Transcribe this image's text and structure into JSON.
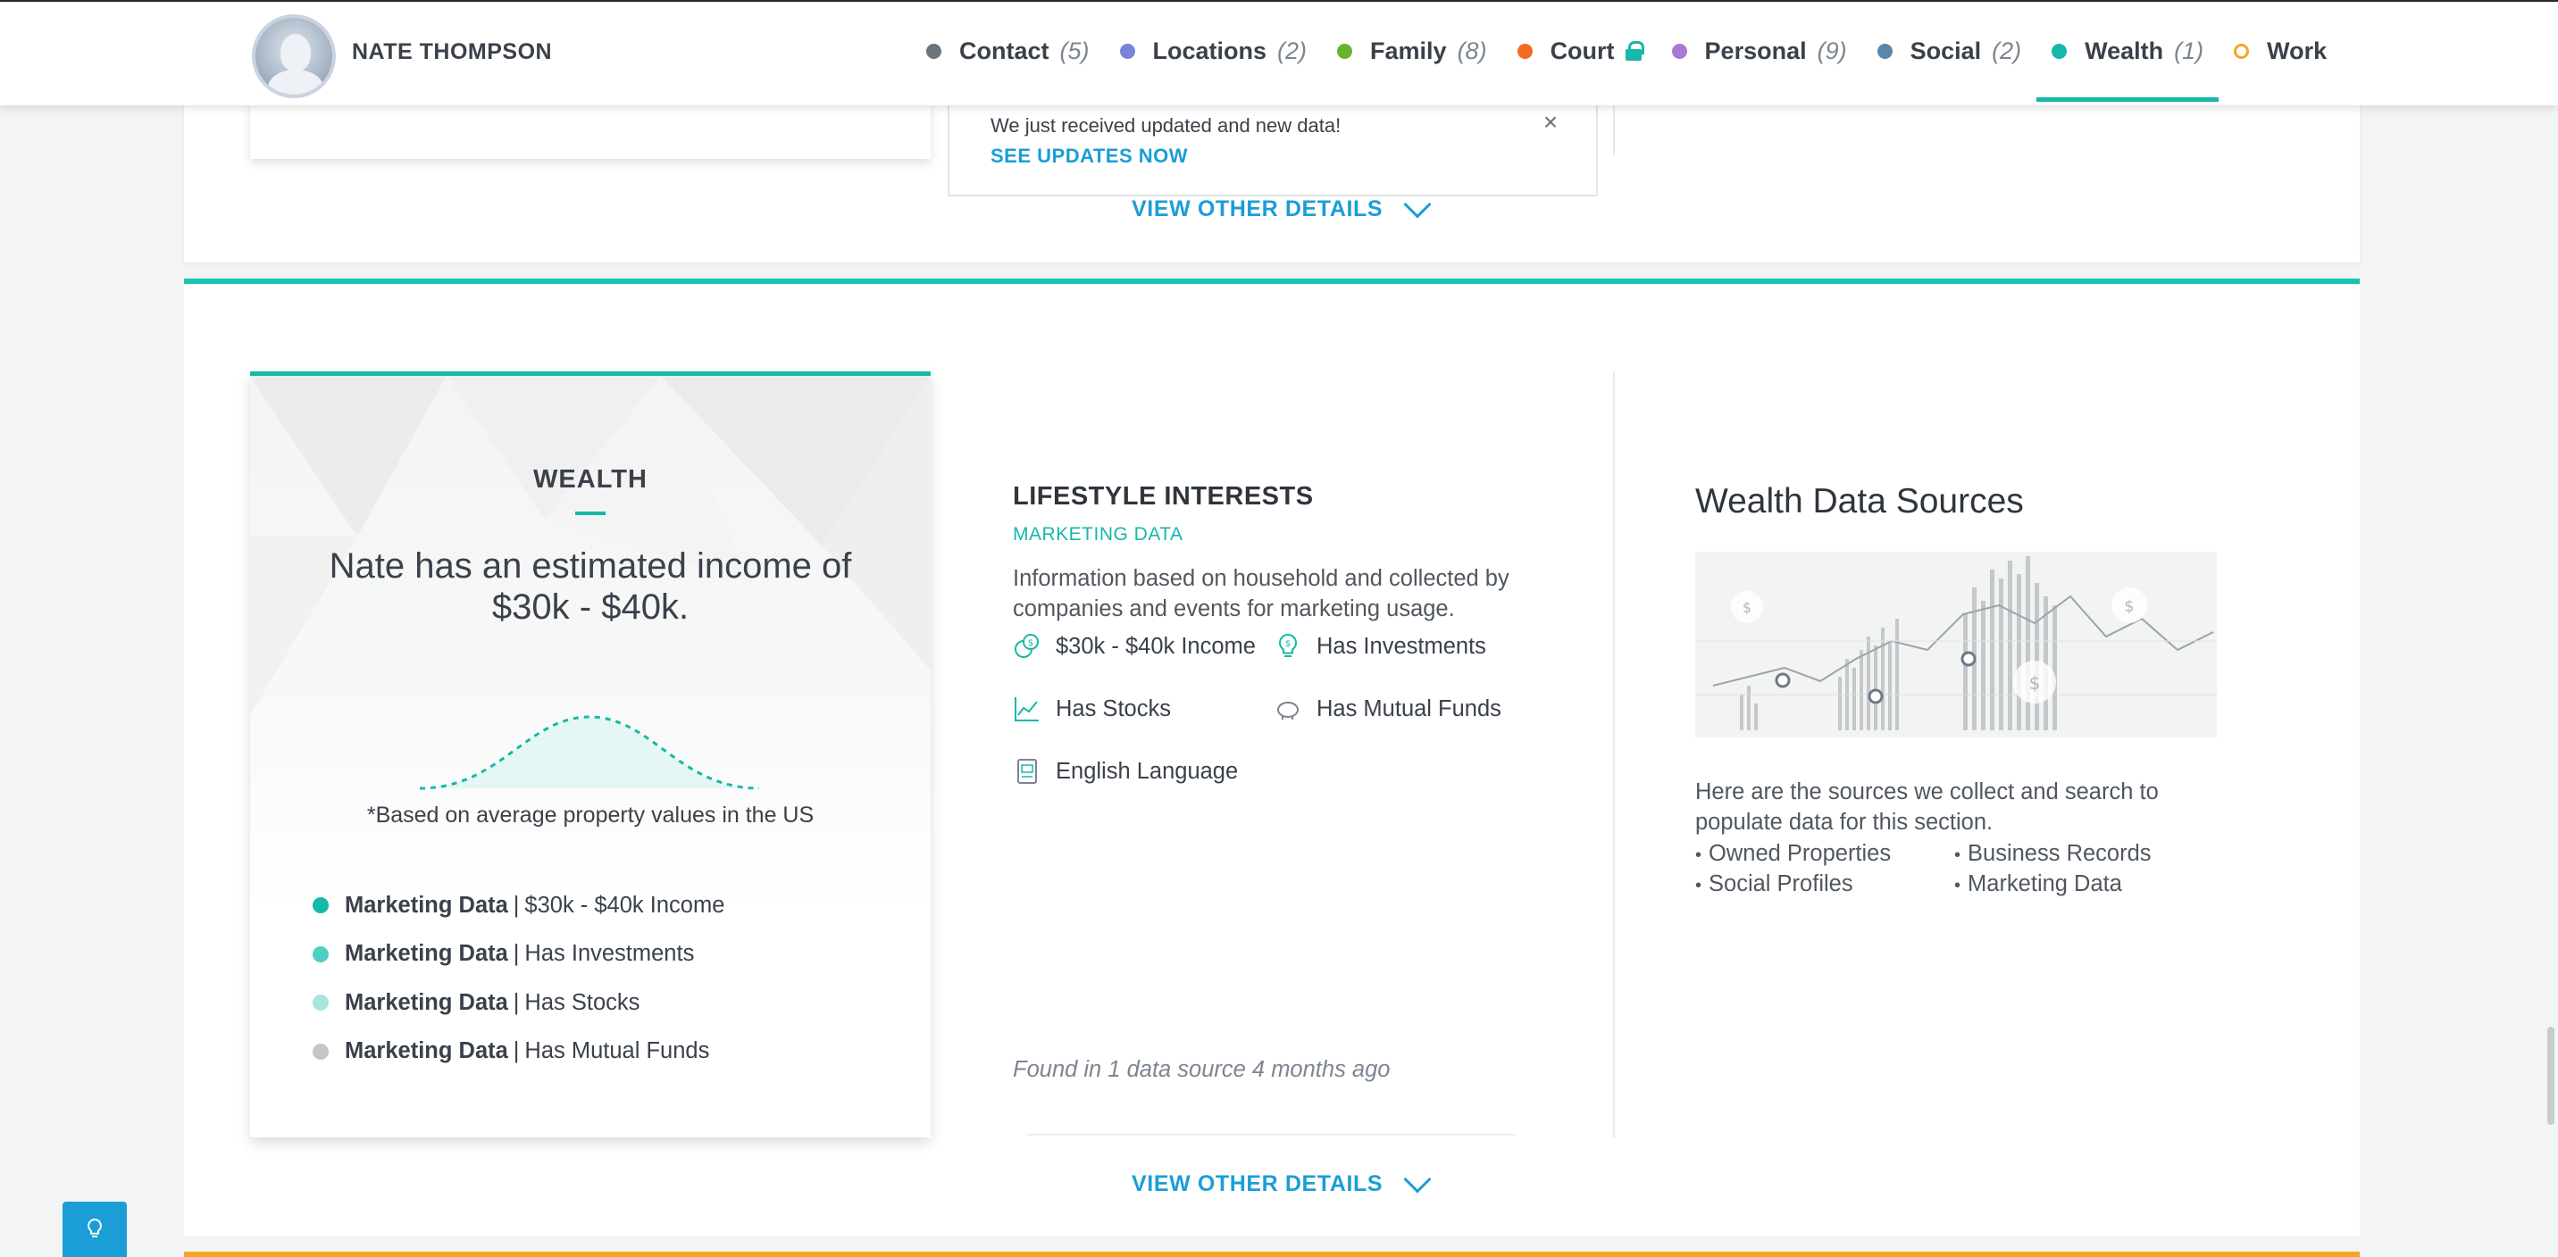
{
  "header": {
    "person_name": "NATE THOMPSON",
    "nav": [
      {
        "label": "Contact",
        "count": "(5)",
        "color": "#6b7580"
      },
      {
        "label": "Locations",
        "count": "(2)",
        "color": "#7b83d6"
      },
      {
        "label": "Family",
        "count": "(8)",
        "color": "#6ab42d"
      },
      {
        "label": "Court",
        "count": "",
        "color": "#f26b21",
        "locked": true
      },
      {
        "label": "Personal",
        "count": "(9)",
        "color": "#a77ad6"
      },
      {
        "label": "Social",
        "count": "(2)",
        "color": "#5b86a8"
      },
      {
        "label": "Wealth",
        "count": "(1)",
        "color": "#16b8a8",
        "active": true
      },
      {
        "label": "Work",
        "count": "",
        "color": "#f5a623",
        "hollow": true
      }
    ]
  },
  "toast": {
    "message": "We just received updated and new data!",
    "link": "SEE UPDATES NOW",
    "close_icon": "close-icon"
  },
  "prev_section": {
    "view_details": "VIEW OTHER DETAILS"
  },
  "wealth": {
    "card": {
      "title": "WEALTH",
      "headline": "Nate has an estimated income of $30k - $40k.",
      "note": "*Based on average property values in the US",
      "legend": [
        {
          "source": "Marketing Data",
          "sep": "|",
          "value": "$30k - $40k Income",
          "color": "#16b8a8"
        },
        {
          "source": "Marketing Data",
          "sep": "|",
          "value": "Has Investments",
          "color": "#4fcfc2"
        },
        {
          "source": "Marketing Data",
          "sep": "|",
          "value": "Has Stocks",
          "color": "#a6e6df"
        },
        {
          "source": "Marketing Data",
          "sep": "|",
          "value": "Has Mutual Funds",
          "color": "#c4c7ca"
        }
      ]
    },
    "lifestyle": {
      "title": "LIFESTYLE INTERESTS",
      "subtitle": "MARKETING DATA",
      "description": "Information based on household and collected by companies and events for marketing usage.",
      "items": [
        {
          "label": "$30k - $40k Income",
          "icon": "coins-icon"
        },
        {
          "label": "Has Investments",
          "icon": "money-bulb-icon"
        },
        {
          "label": "Has Stocks",
          "icon": "stock-chart-icon"
        },
        {
          "label": "Has Mutual Funds",
          "icon": "piggy-bank-icon"
        },
        {
          "label": "English Language",
          "icon": "language-book-icon"
        }
      ],
      "found": "Found in 1 data source 4 months ago"
    },
    "sources": {
      "title": "Wealth Data Sources",
      "description": "Here are the sources we collect and search to populate data for this section.",
      "list": [
        "Owned Properties",
        "Business Records",
        "Social Profiles",
        "Marketing Data"
      ]
    },
    "view_details": "VIEW OTHER DETAILS"
  },
  "colors": {
    "accent": "#16b8a8",
    "link": "#1b9ed6",
    "work": "#f5a623"
  }
}
